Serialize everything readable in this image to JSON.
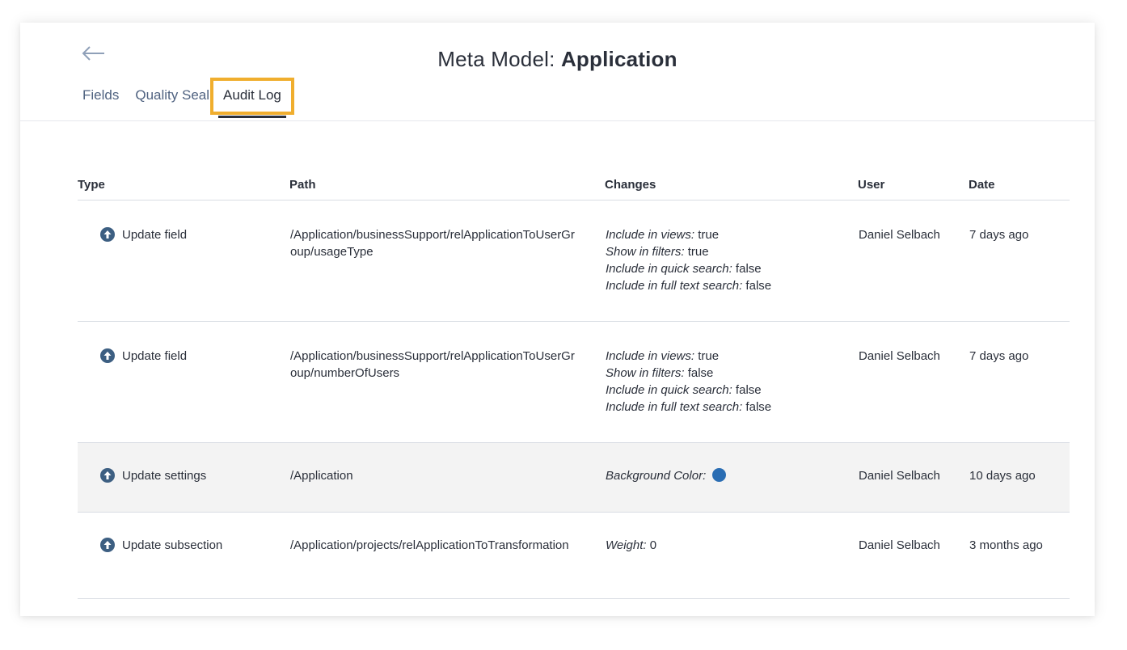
{
  "header": {
    "title_prefix": "Meta Model: ",
    "title_strong": "Application",
    "tabs": [
      {
        "label": "Fields"
      },
      {
        "label": "Quality Seal"
      },
      {
        "label": "Audit Log"
      }
    ]
  },
  "icons": {
    "back": "arrow-left-icon",
    "update": "arrow-up-circle-icon"
  },
  "table": {
    "columns": [
      "Type",
      "Path",
      "Changes",
      "User",
      "Date"
    ],
    "rows": [
      {
        "type": "Update field",
        "path": "/Application/businessSupport/relApplicationToUserGroup/usageType",
        "changes": [
          {
            "key": "Include in views:",
            "value": " true"
          },
          {
            "key": "Show in filters:",
            "value": " true"
          },
          {
            "key": "Include in quick search:",
            "value": " false"
          },
          {
            "key": "Include in full text search:",
            "value": " false"
          }
        ],
        "user": "Daniel Selbach",
        "date": "7 days ago"
      },
      {
        "type": "Update field",
        "path": "/Application/businessSupport/relApplicationToUserGroup/numberOfUsers",
        "changes": [
          {
            "key": "Include in views:",
            "value": " true"
          },
          {
            "key": "Show in filters:",
            "value": " false"
          },
          {
            "key": "Include in quick search:",
            "value": " false"
          },
          {
            "key": "Include in full text search:",
            "value": " false"
          }
        ],
        "user": "Daniel Selbach",
        "date": "7 days ago"
      },
      {
        "type": "Update settings",
        "path": "/Application",
        "changes": [
          {
            "key": "Background Color:",
            "value": ""
          }
        ],
        "swatch_color": "#2a6db3",
        "user": "Daniel Selbach",
        "date": "10 days ago"
      },
      {
        "type": "Update subsection",
        "path": "/Application/projects/relApplicationToTransformation",
        "changes": [
          {
            "key": "Weight:",
            "value": " 0"
          }
        ],
        "user": "Daniel Selbach",
        "date": "3 months ago"
      }
    ]
  },
  "colors": {
    "highlight_outline": "#f0ae2e",
    "icon": "#3d5f82",
    "row_highlight": "#f3f3f3"
  }
}
